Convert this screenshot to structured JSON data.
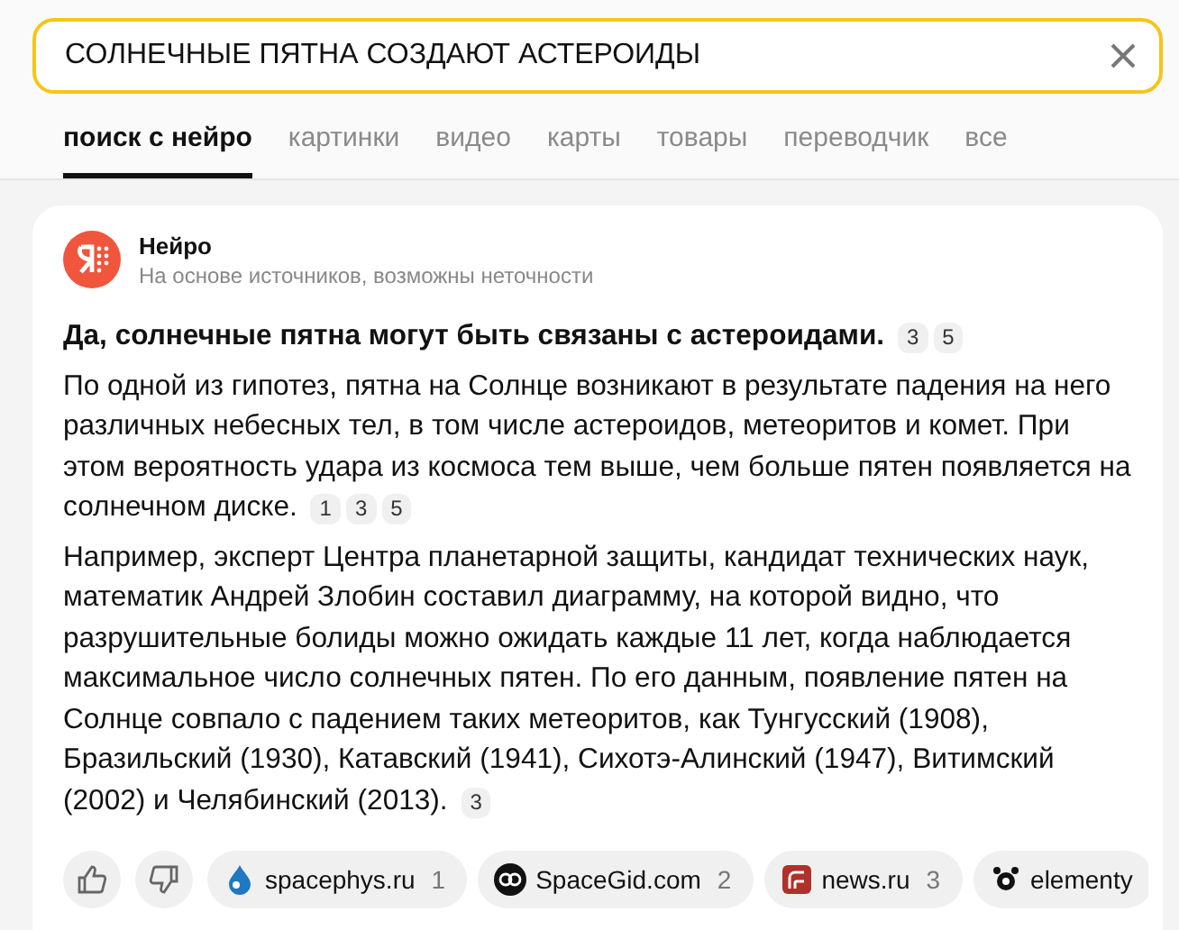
{
  "search": {
    "value": "СОЛНЕЧНЫЕ ПЯТНА СОЗДАЮТ АСТЕРОИДЫ"
  },
  "tabs": [
    {
      "label": "поиск с нейро",
      "selected": true
    },
    {
      "label": "картинки",
      "selected": false
    },
    {
      "label": "видео",
      "selected": false
    },
    {
      "label": "карты",
      "selected": false
    },
    {
      "label": "товары",
      "selected": false
    },
    {
      "label": "переводчик",
      "selected": false
    },
    {
      "label": "все",
      "selected": false
    }
  ],
  "answer": {
    "source_name": "Нейро",
    "disclaimer": "На основе источников, возможны неточности",
    "paragraphs": [
      {
        "kind": "headline",
        "text": "Да, солнечные пятна могут быть связаны с астероидами.",
        "refs": [
          "3",
          "5"
        ]
      },
      {
        "kind": "body",
        "text": "По одной из гипотез, пятна на Солнце возникают в результате падения на него различных небесных тел, в том числе астероидов, метеоритов и комет. При этом вероятность удара из космоса тем выше, чем больше пятен появляется на солнечном диске.",
        "refs": [
          "1",
          "3",
          "5"
        ]
      },
      {
        "kind": "body",
        "text": "Например, эксперт Центра планетарной защиты, кандидат технических наук, математик Андрей Злобин составил диаграмму, на которой видно, что разрушительные болиды можно ожидать каждые 11 лет, когда наблюдается максимальное число солнечных пятен. По его данным, появление пятен на Солнце совпало с падением таких метеоритов, как Тунгусский (1908), Бразильский (1930), Катавский (1941), Сихотэ-Алинский (1947), Витимский (2002) и Челябинский (2013).",
        "refs": [
          "3"
        ]
      }
    ],
    "sources": [
      {
        "kind": "drop",
        "name": "spacephys.ru",
        "number": "1"
      },
      {
        "kind": "badge",
        "name": "SpaceGid.com",
        "number": "2"
      },
      {
        "kind": "feed",
        "name": "news.ru",
        "number": "3"
      },
      {
        "kind": "dots",
        "name": "elementy"
      }
    ]
  }
}
